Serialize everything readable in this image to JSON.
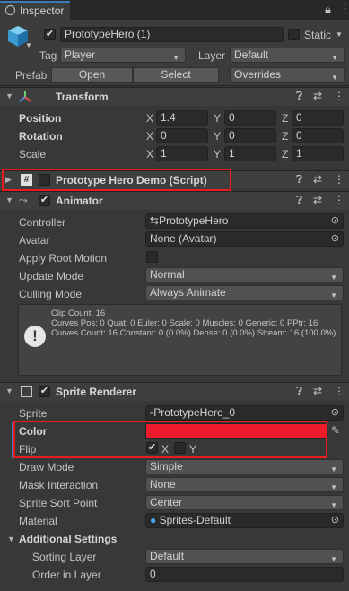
{
  "tab": {
    "title": "Inspector"
  },
  "header": {
    "object_name": "PrototypeHero (1)",
    "static_label": "Static",
    "tag_label": "Tag",
    "tag_value": "Player",
    "layer_label": "Layer",
    "layer_value": "Default",
    "prefab_label": "Prefab",
    "open_label": "Open",
    "select_label": "Select",
    "overrides_label": "Overrides"
  },
  "transform": {
    "title": "Transform",
    "position_label": "Position",
    "position": {
      "x": "1.4",
      "y": "0",
      "z": "0"
    },
    "rotation_label": "Rotation",
    "rotation": {
      "x": "0",
      "y": "0",
      "z": "0"
    },
    "scale_label": "Scale",
    "scale": {
      "x": "1",
      "y": "1",
      "z": "1"
    }
  },
  "script": {
    "title": "Prototype Hero Demo (Script)"
  },
  "animator": {
    "title": "Animator",
    "controller_label": "Controller",
    "controller_value": "PrototypeHero",
    "avatar_label": "Avatar",
    "avatar_value": "None (Avatar)",
    "root_motion_label": "Apply Root Motion",
    "update_mode_label": "Update Mode",
    "update_mode_value": "Normal",
    "culling_mode_label": "Culling Mode",
    "culling_mode_value": "Always Animate",
    "info": "Clip Count: 16\nCurves Pos: 0 Quat: 0 Euler: 0 Scale: 0 Muscles: 0 Generic: 0 PPtr: 16\nCurves Count: 16 Constant: 0 (0.0%) Dense: 0 (0.0%) Stream: 16 (100.0%)"
  },
  "sprite_renderer": {
    "title": "Sprite Renderer",
    "sprite_label": "Sprite",
    "sprite_value": "PrototypeHero_0",
    "color_label": "Color",
    "color_value": "#ee1c2a",
    "flip_label": "Flip",
    "flip_x": "X",
    "flip_y": "Y",
    "draw_mode_label": "Draw Mode",
    "draw_mode_value": "Simple",
    "mask_label": "Mask Interaction",
    "mask_value": "None",
    "sort_point_label": "Sprite Sort Point",
    "sort_point_value": "Center",
    "material_label": "Material",
    "material_value": "Sprites-Default",
    "additional_label": "Additional Settings",
    "sorting_layer_label": "Sorting Layer",
    "sorting_layer_value": "Default",
    "order_label": "Order in Layer",
    "order_value": "0"
  }
}
